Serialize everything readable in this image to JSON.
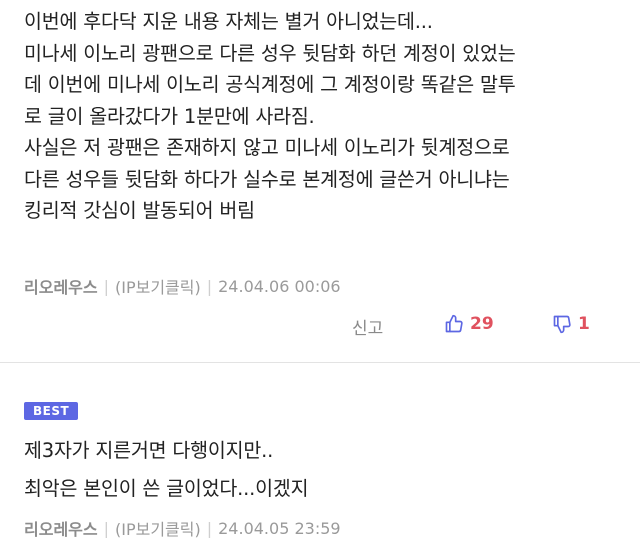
{
  "comment1": {
    "lines": [
      "이번에 후다닥 지운 내용 자체는 별거 아니었는데...",
      "미나세 이노리 광팬으로 다른 성우 뒷담화 하던 계정이 있었는",
      "데 이번에 미나세 이노리 공식계정에 그 계정이랑 똑같은 말투",
      "로 글이 올라갔다가 1분만에 사라짐.",
      "사실은 저 광팬은 존재하지 않고 미나세 이노리가 뒷계정으로",
      "다른 성우들 뒷담화 하다가 실수로 본계정에 글쓴거 아니냐는",
      "킹리적 갓심이 발동되어 버림"
    ],
    "author": "리오레우스",
    "ip_label": "(IP보기클릭)",
    "timestamp": "24.04.06 00:06",
    "report_label": "신고",
    "upvotes": "29",
    "downvotes": "1"
  },
  "comment2": {
    "badge": "BEST",
    "lines": [
      "제3자가 지른거면 다행이지만..",
      "최악은 본인이 쓴 글이었다...이겠지"
    ],
    "author": "리오레우스",
    "ip_label": "(IP보기클릭)",
    "timestamp": "24.04.05 23:59"
  },
  "colors": {
    "accent": "#5d67e3",
    "vote": "#e0525f",
    "meta_text": "#9a9a9a"
  },
  "icons": [
    "thumbs-up-icon",
    "thumbs-down-icon"
  ]
}
